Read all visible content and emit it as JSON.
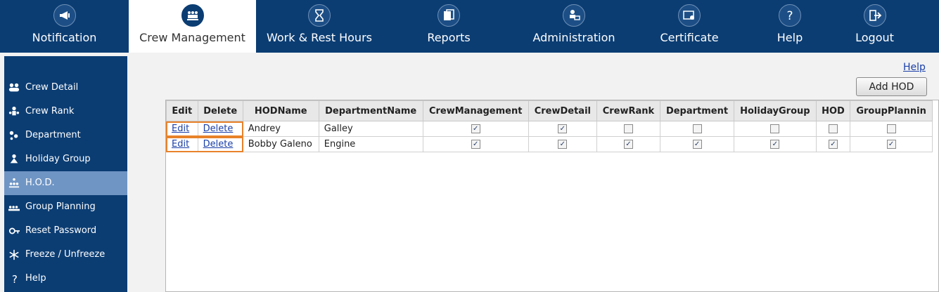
{
  "topnav": [
    {
      "label": "Notification",
      "icon": "megaphone-icon",
      "active": false
    },
    {
      "label": "Crew Management",
      "icon": "crew-group-icon",
      "active": true
    },
    {
      "label": "Work & Rest Hours",
      "icon": "hourglass-icon",
      "active": false
    },
    {
      "label": "Reports",
      "icon": "documents-icon",
      "active": false
    },
    {
      "label": "Administration",
      "icon": "admin-computer-icon",
      "active": false
    },
    {
      "label": "Certificate",
      "icon": "certificate-icon",
      "active": false
    },
    {
      "label": "Help",
      "icon": "question-icon",
      "active": false
    },
    {
      "label": "Logout",
      "icon": "logout-icon",
      "active": false
    }
  ],
  "sidebar": [
    {
      "label": "Crew Detail",
      "icon": "crew-detail-icon",
      "active": false
    },
    {
      "label": "Crew Rank",
      "icon": "crew-rank-icon",
      "active": false
    },
    {
      "label": "Department",
      "icon": "department-icon",
      "active": false
    },
    {
      "label": "Holiday Group",
      "icon": "holiday-group-icon",
      "active": false
    },
    {
      "label": "H.O.D.",
      "icon": "hod-icon",
      "active": true
    },
    {
      "label": "Group Planning",
      "icon": "group-planning-icon",
      "active": false
    },
    {
      "label": "Reset Password",
      "icon": "reset-password-icon",
      "active": false
    },
    {
      "label": "Freeze / Unfreeze",
      "icon": "snowflake-icon",
      "active": false
    },
    {
      "label": "Help",
      "icon": "question-icon",
      "active": false
    }
  ],
  "content": {
    "help_link": "Help",
    "add_button": "Add HOD",
    "table": {
      "columns": [
        "Edit",
        "Delete",
        "HODName",
        "DepartmentName",
        "CrewManagement",
        "CrewDetail",
        "CrewRank",
        "Department",
        "HolidayGroup",
        "HOD",
        "GroupPlannin"
      ],
      "rows": [
        {
          "edit": "Edit",
          "delete": "Delete",
          "hod_name": "Andrey",
          "department_name": "Galley",
          "checks": [
            true,
            true,
            false,
            false,
            false,
            false,
            false
          ]
        },
        {
          "edit": "Edit",
          "delete": "Delete",
          "hod_name": "Bobby Galeno",
          "department_name": "Engine",
          "checks": [
            true,
            true,
            true,
            true,
            true,
            true,
            true
          ]
        }
      ]
    }
  },
  "colors": {
    "nav_bg": "#0b3d73",
    "sidebar_active": "#6f95c4",
    "highlight": "#e8822a",
    "link": "#1a3fa8"
  }
}
